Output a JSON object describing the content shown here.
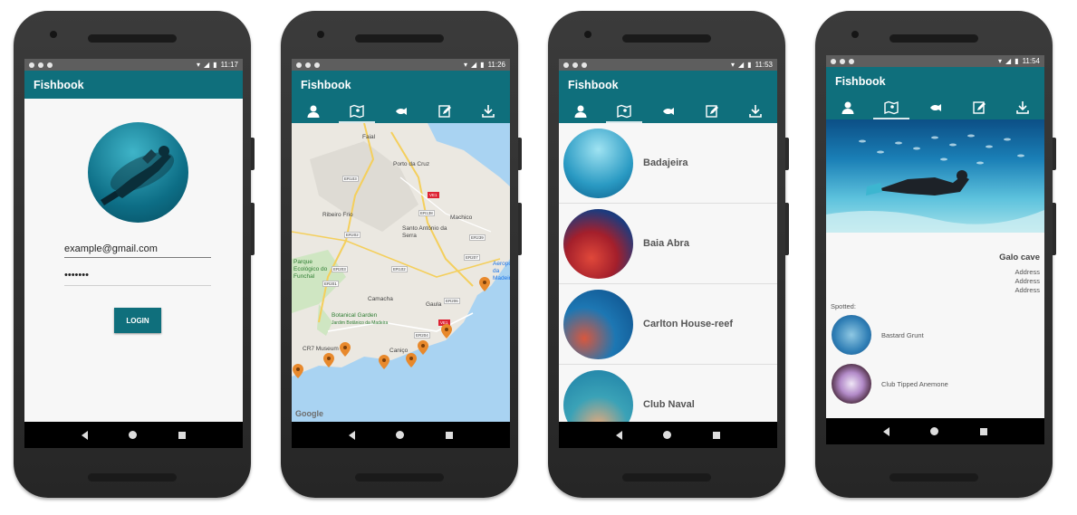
{
  "app_title": "Fishbook",
  "screens": [
    {
      "time": "11:17"
    },
    {
      "time": "11:26"
    },
    {
      "time": "11:53"
    },
    {
      "time": "11:54"
    }
  ],
  "login": {
    "email_value": "example@gmail.com",
    "password_value": "•••••••",
    "login_label": "LOGIN"
  },
  "tabs": [
    "profile-icon",
    "map-icon",
    "fish-icon",
    "edit-icon",
    "download-icon"
  ],
  "map": {
    "labels": [
      "Faial",
      "Porto da Cruz",
      "Ribeiro Frio",
      "Santo António da Serra",
      "Machico",
      "Parque Ecológico do Funchal",
      "Camacha",
      "Gaula",
      "Botanical Garden",
      "Jardim Botânico da Madeira",
      "CR7 Museum",
      "Caniço",
      "Aeroporto da Madeira"
    ],
    "roads": [
      "ER103",
      "VE1",
      "ER138",
      "ER202",
      "ER239",
      "ER207",
      "ER203",
      "ER102",
      "ER201",
      "ER206",
      "ER204",
      "VE1"
    ],
    "attribution": "Google"
  },
  "spots": [
    {
      "name": "Badajeira"
    },
    {
      "name": "Baia Abra"
    },
    {
      "name": "Carlton House-reef"
    },
    {
      "name": "Club Naval"
    }
  ],
  "detail": {
    "title": "Galo cave",
    "address_lines": [
      "Address",
      "Address",
      "Address"
    ],
    "spotted_label": "Spotted:",
    "fish": [
      {
        "name": "Bastard Grunt"
      },
      {
        "name": "Club Tipped Anemone"
      }
    ]
  }
}
